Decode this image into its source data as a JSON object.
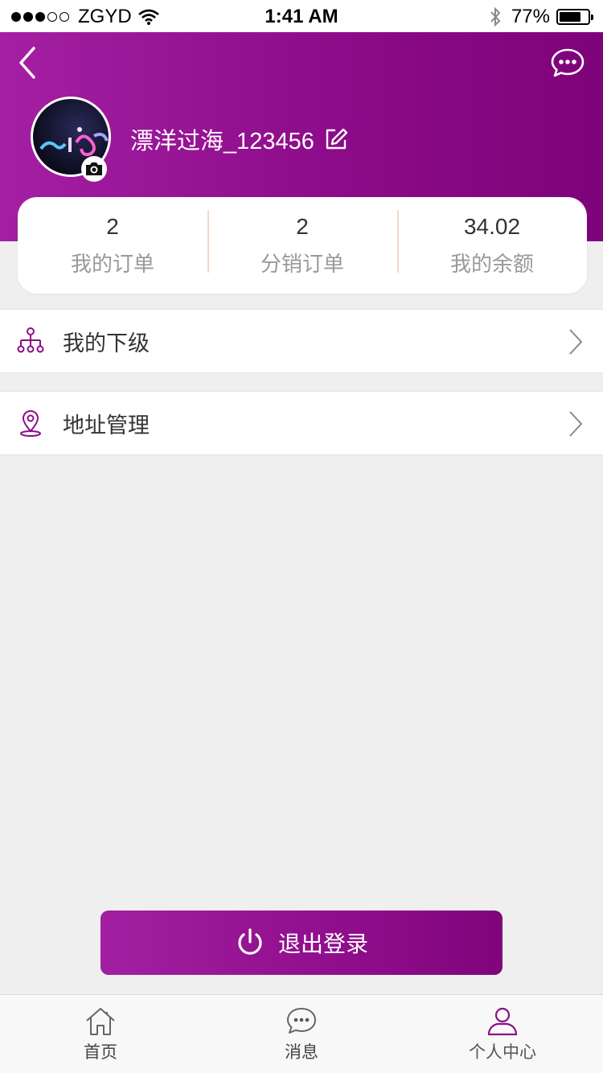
{
  "status_bar": {
    "carrier": "ZGYD",
    "time": "1:41 AM",
    "battery": "77%",
    "battery_level": 0.77
  },
  "header": {
    "username": "漂洋过海_123456",
    "back_icon": "chevron-left-icon",
    "message_icon": "chat-bubble-icon",
    "edit_icon": "edit-icon",
    "camera_icon": "camera-icon",
    "accent_start": "#a41fa3",
    "accent_end": "#7e0379"
  },
  "stats": [
    {
      "value": "2",
      "label": "我的订单"
    },
    {
      "value": "2",
      "label": "分销订单"
    },
    {
      "value": "34.02",
      "label": "我的余额"
    }
  ],
  "menu": [
    {
      "label": "我的下级",
      "icon": "hierarchy-icon"
    },
    {
      "label": "地址管理",
      "icon": "location-pin-icon"
    }
  ],
  "logout": {
    "label": "退出登录",
    "icon": "power-icon"
  },
  "tabs": [
    {
      "label": "首页",
      "icon": "home-icon",
      "active": false
    },
    {
      "label": "消息",
      "icon": "chat-bubble-icon",
      "active": false
    },
    {
      "label": "个人中心",
      "icon": "user-icon",
      "active": true
    }
  ]
}
